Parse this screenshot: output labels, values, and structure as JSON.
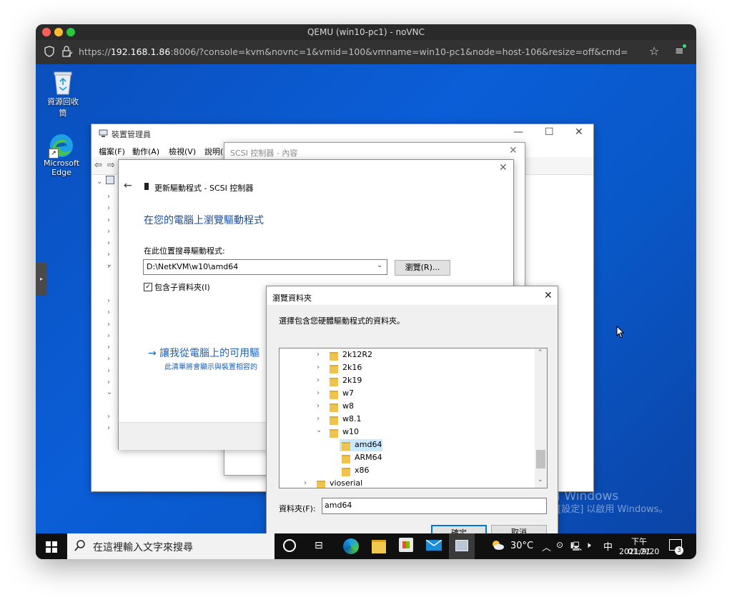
{
  "browser": {
    "window_title": "QEMU (win10-pc1) - noVNC",
    "url_prefix": "https://",
    "url_host": "192.168.1.86",
    "url_rest": ":8006/?console=kvm&novnc=1&vmid=100&vmname=win10-pc1&node=host-106&resize=off&cmd="
  },
  "desktop": {
    "icons": [
      {
        "label": "資源回收筒",
        "icon": "recycle-bin-icon"
      },
      {
        "label": "Microsoft Edge",
        "icon": "edge-icon"
      }
    ],
    "watermark_title": "啟用 Windows",
    "watermark_sub": "移至 [設定] 以啟用 Windows。"
  },
  "device_manager": {
    "title": "裝置管理員",
    "menu": [
      "檔案(F)",
      "動作(A)",
      "檢視(V)",
      "說明(H)"
    ]
  },
  "scsi_props": {
    "title": "SCSI 控制器 - 內容"
  },
  "update_driver": {
    "header": "更新驅動程式 - SCSI 控制器",
    "heading": "在您的電腦上瀏覽驅動程式",
    "search_label": "在此位置搜尋驅動程式:",
    "path_value": "D:\\NetKVM\\w10\\amd64",
    "browse_button": "瀏覽(R)...",
    "include_subfolders": "包含子資料夾(I)",
    "link_text": "→ 讓我從電腦上的可用驅",
    "link_sub": "此清單將會顯示與裝置相容的"
  },
  "browse_folder": {
    "title": "瀏覽資料夾",
    "instruction": "選擇包含您硬體驅動程式的資料夾。",
    "tree": [
      {
        "label": "2k12R2",
        "expanded": false
      },
      {
        "label": "2k16",
        "expanded": false
      },
      {
        "label": "2k19",
        "expanded": false
      },
      {
        "label": "w7",
        "expanded": false
      },
      {
        "label": "w8",
        "expanded": false
      },
      {
        "label": "w8.1",
        "expanded": false
      },
      {
        "label": "w10",
        "expanded": true
      },
      {
        "label": "amd64",
        "selected": true
      },
      {
        "label": "ARM64"
      },
      {
        "label": "x86"
      },
      {
        "label": "vioserial",
        "expanded": false
      }
    ],
    "folder_label": "資料夾(F):",
    "folder_value": "amd64",
    "ok_button": "確定",
    "cancel_button": "取消"
  },
  "taskbar": {
    "search_placeholder": "在這裡輸入文字來搜尋",
    "weather": "30°C",
    "ime": "中",
    "time": "下午 01:21",
    "date": "2021/9/20",
    "notification_count": "3"
  },
  "colors": {
    "accent": "#0078d7",
    "link": "#1a62b8",
    "desktop": "#0b5ed7",
    "selection": "#cce8ff"
  }
}
